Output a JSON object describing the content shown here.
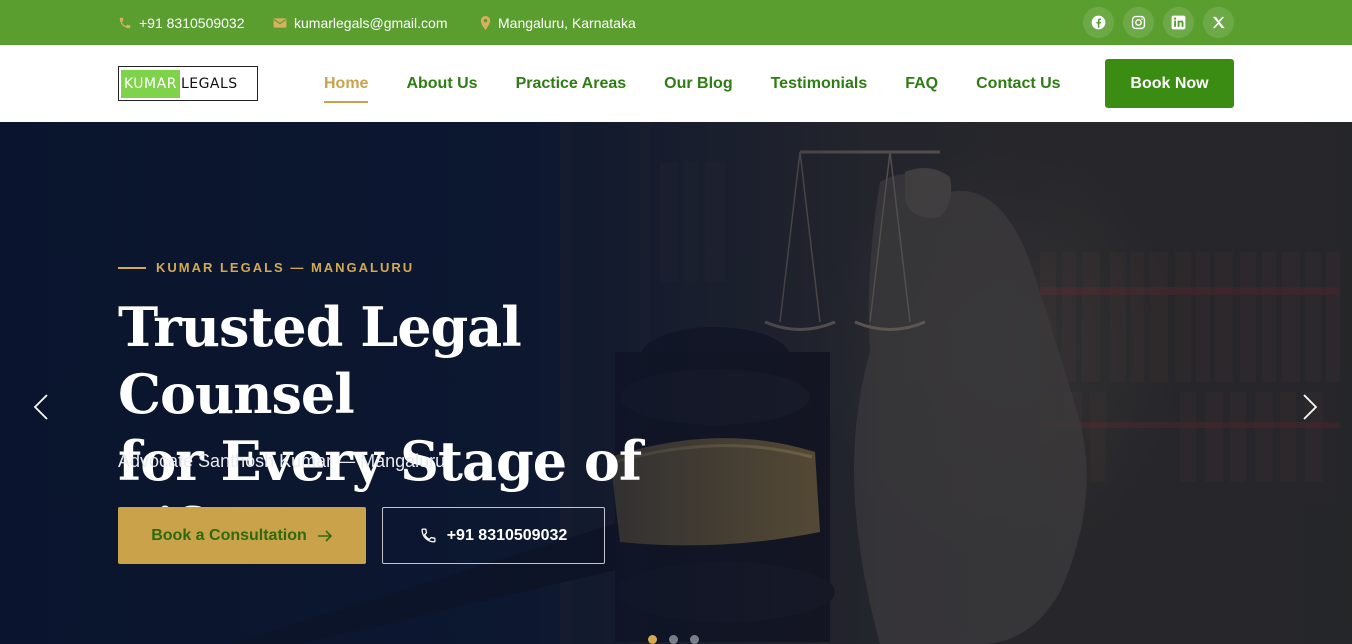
{
  "topbar": {
    "phone": "+91 8310509032",
    "email": "kumarlegals@gmail.com",
    "location": "Mangaluru, Karnataka",
    "socials": [
      "facebook-icon",
      "instagram-icon",
      "linkedin-icon",
      "x-icon"
    ]
  },
  "logo": {
    "part1": "KUMAR",
    "part2": "LEGALS"
  },
  "nav": {
    "items": [
      {
        "label": "Home",
        "active": true
      },
      {
        "label": "About Us"
      },
      {
        "label": "Practice Areas"
      },
      {
        "label": "Our Blog"
      },
      {
        "label": "Testimonials"
      },
      {
        "label": "FAQ"
      },
      {
        "label": "Contact Us"
      }
    ],
    "cta": "Book Now"
  },
  "hero": {
    "eyebrow": "KUMAR LEGALS — MANGALURU",
    "title_line1": "Trusted Legal Counsel",
    "title_line2": "for Every Stage of Life",
    "subtitle": "Advocate Santhosh Kumar — Mangaluru",
    "primary_button": "Book a Consultation",
    "secondary_button": "+91 8310509032",
    "slides": 3,
    "active_slide": 1
  },
  "colors": {
    "topbar": "#5a9e2f",
    "nav_link": "#2e7d12",
    "gold": "#c9a24a",
    "cta_green": "#3a8c12"
  }
}
